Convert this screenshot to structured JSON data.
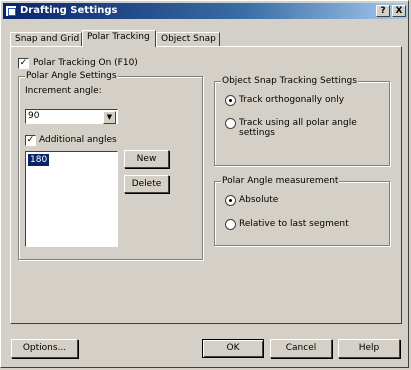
{
  "window": {
    "title": "Drafting Settings"
  },
  "titlebar": {
    "help_label": "?",
    "close_label": "X"
  },
  "tabs": [
    {
      "label": "Snap and Grid"
    },
    {
      "label": "Polar Tracking"
    },
    {
      "label": "Object Snap"
    }
  ],
  "polar_tracking_on": {
    "label": "Polar Tracking On (F10)",
    "checked": true
  },
  "polar_angle_settings": {
    "group_label": "Polar Angle Settings",
    "increment_label": "Increment angle:",
    "increment_value": "90",
    "additional_angles": {
      "label": "Additional angles",
      "checked": true
    },
    "angles_list": [
      "180"
    ],
    "new_label": "New",
    "delete_label": "Delete"
  },
  "object_snap_tracking": {
    "group_label": "Object Snap Tracking Settings",
    "options": [
      {
        "label": "Track orthogonally only",
        "selected": true
      },
      {
        "label": "Track using all polar angle settings",
        "selected": false
      }
    ]
  },
  "polar_angle_measurement": {
    "group_label": "Polar Angle measurement",
    "options": [
      {
        "label": "Absolute",
        "selected": true
      },
      {
        "label": "Relative to last segment",
        "selected": false
      }
    ]
  },
  "footer": {
    "options_label": "Options...",
    "ok_label": "OK",
    "cancel_label": "Cancel",
    "help_label": "Help"
  }
}
